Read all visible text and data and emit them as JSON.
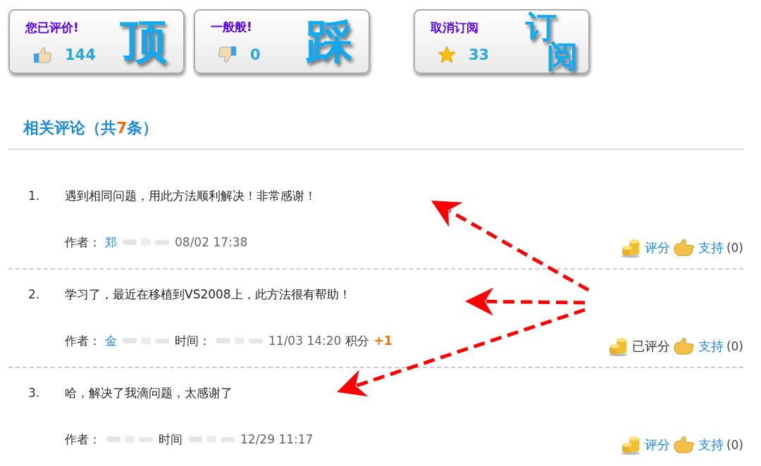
{
  "votes": [
    {
      "kind": "up",
      "label": "您已评价!",
      "count": "144",
      "big": [
        "顶"
      ]
    },
    {
      "kind": "down",
      "label": "一般般!",
      "count": "0",
      "big": [
        "踩"
      ]
    },
    {
      "kind": "star",
      "label": "取消订阅",
      "count": "33",
      "big": [
        "订",
        "阅"
      ]
    }
  ],
  "comments_heading": {
    "before": "相关评论（共",
    "count": "7",
    "after": "条）"
  },
  "comments": [
    {
      "number": "1.",
      "text": "遇到相同问题，用此方法顺利解决！非常感谢！",
      "meta": [
        {
          "kind": "label",
          "text": "作者："
        },
        {
          "kind": "author",
          "text": "郑"
        },
        {
          "kind": "blur"
        },
        {
          "kind": "text",
          "text": "08/02 17:38"
        }
      ],
      "rate": "评分",
      "rated": false,
      "support": "支持",
      "support_count": "(0)"
    },
    {
      "number": "2.",
      "text": "学习了，最近在移植到VS2008上，此方法很有帮助！",
      "meta": [
        {
          "kind": "label",
          "text": "作者："
        },
        {
          "kind": "author",
          "text": "金"
        },
        {
          "kind": "blur"
        },
        {
          "kind": "label",
          "text": "时间："
        },
        {
          "kind": "blur"
        },
        {
          "kind": "text",
          "text": "11/03 14:20"
        },
        {
          "kind": "label",
          "text": "积分"
        },
        {
          "kind": "points",
          "text": "+1"
        }
      ],
      "rate": "已评分",
      "rated": true,
      "support": "支持",
      "support_count": "(0)"
    },
    {
      "number": "3.",
      "text": "哈，解决了我滴问题，太感谢了",
      "meta": [
        {
          "kind": "label",
          "text": "作者："
        },
        {
          "kind": "blur"
        },
        {
          "kind": "label",
          "text": "时间"
        },
        {
          "kind": "blur"
        },
        {
          "kind": "text",
          "text": "12/29 11:17"
        }
      ],
      "rate": "评分",
      "rated": false,
      "support": "支持",
      "support_count": "(0)"
    }
  ]
}
